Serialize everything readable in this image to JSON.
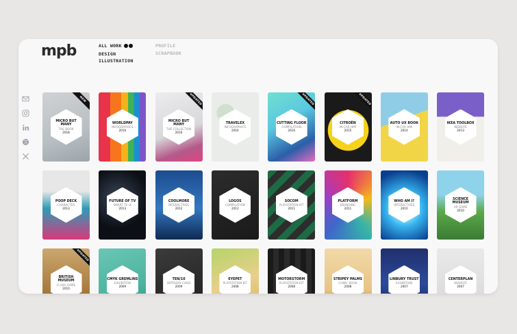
{
  "logo": "mpb",
  "nav": {
    "primary": [
      "ALL WORK",
      "DESIGN",
      "ILLUSTRATION"
    ],
    "secondary": [
      "PROFILE",
      "SCRAPBOOK"
    ]
  },
  "social_icons": [
    "email-icon",
    "instagram-icon",
    "linkedin-icon",
    "dribbble-icon",
    "x-icon"
  ],
  "cards": [
    {
      "title": "MICRO BUT MANY",
      "subtitle": "THE BOOK",
      "year": "2018",
      "badge": "NEW",
      "bg": "linear-gradient(160deg,#cfd2d4 0%,#b8bfc3 60%,#9aa4a9 100%)"
    },
    {
      "title": "WORLDPAY",
      "subtitle": "INFOGRAPHICS",
      "year": "2016",
      "badge": "",
      "bg": "linear-gradient(90deg,#e8344a 0 25%,#f7761d 25% 48%,#f4b119 48% 62%,#3db356 62% 75%,#1c8fd0 75% 87%,#7c55c9 87% 100%)"
    },
    {
      "title": "MICRO BUT MANY",
      "subtitle": "THE COLLECTION",
      "year": "2016",
      "badge": "UPDATED",
      "bg": "linear-gradient(160deg,#ecebed 0%,#d8d7da 55%,#b45a8a 80%,#e0447f 100%)"
    },
    {
      "title": "TRAVELEX",
      "subtitle": "INFOGRAPHICS",
      "year": "2016",
      "badge": "",
      "bg": "radial-gradient(circle at 30% 30%,#cfe0cf 0 15%,#e9ece9 16% 100%)"
    },
    {
      "title": "CUTTING FLOOR",
      "subtitle": "COMPILATION",
      "year": "2016",
      "badge": "UPDATED",
      "bg": "linear-gradient(150deg,#70e0d0 0%,#5ac8e0 40%,#2b5ea8 75%,#e46cc0 100%)"
    },
    {
      "title": "CITROËN",
      "subtitle": "IN-CAR HMI",
      "year": "2015",
      "badge": "UPDATED",
      "bg": "radial-gradient(circle at 50% 55%,#f6d21b 0 45%,#1a1a1a 46% 100%)"
    },
    {
      "title": "AUTO UX BOOK",
      "subtitle": "IN-CAR HMI",
      "year": "2014",
      "badge": "",
      "bg": "linear-gradient(160deg,#8fcde6 0 40%,#f1d546 40% 100%)"
    },
    {
      "title": "IKEA TOOLBOX",
      "subtitle": "WEBSITE",
      "year": "2013",
      "badge": "",
      "bg": "linear-gradient(180deg,#7a5fc8 0 35%,#f1efea 35% 100%)"
    },
    {
      "title": "POOP DECK",
      "subtitle": "CHARACTER",
      "year": "2013",
      "badge": "",
      "bg": "linear-gradient(180deg,#e7e7e7 0 30%,#2f9bb5 55%,#d8397b 100%)"
    },
    {
      "title": "FUTURE OF TV",
      "subtitle": "SMART TV UI",
      "year": "2013",
      "badge": "",
      "bg": "radial-gradient(circle at 40% 40%,#2a3340 0 20%,#0c1016 60%)"
    },
    {
      "title": "COOLMORE",
      "subtitle": "INTERACTIVES",
      "year": "2012",
      "badge": "",
      "bg": "linear-gradient(180deg,#1c4c8f 0%,#3477c0 55%,#0e2a52 100%)"
    },
    {
      "title": "LOGOS",
      "subtitle": "COMPILATION",
      "year": "2012",
      "badge": "",
      "bg": "linear-gradient(160deg,#2c2c2c 0%,#1a1a1a 100%)"
    },
    {
      "title": "SOCOM",
      "subtitle": "PLAYSTATION KIT",
      "year": "2011",
      "badge": "",
      "bg": "repeating-linear-gradient(135deg,#1d6a44 0 10px,#2d2d2d 10px 20px)"
    },
    {
      "title": "PLATFORM",
      "subtitle": "BRANDING",
      "year": "2011",
      "badge": "",
      "bg": "conic-gradient(#e6306d,#f5b91b,#36b4a8,#3f66c9,#9b3fc6,#e6306d)"
    },
    {
      "title": "WHO AM I?",
      "subtitle": "INTERACTIVES",
      "year": "2010",
      "badge": "",
      "bg": "radial-gradient(circle at 50% 55%,#bff4ff 0 15%,#36b4ef 40%,#0a3f8f 85%)"
    },
    {
      "title": "SCIENCE MUSEUM",
      "subtitle": "AR GAME",
      "year": "2010",
      "badge": "",
      "bg": "linear-gradient(180deg,#8fd3eb 0 35%,#5aa848 60%,#3c7b35 100%)"
    },
    {
      "title": "BRITISH MUSEUM",
      "subtitle": "FLASH GAME",
      "year": "2010",
      "badge": "UPDATED",
      "bg": "linear-gradient(180deg,#caa76e 0%,#a97a3f 60%,#6b4520 100%)"
    },
    {
      "title": "CMYK GREMLINS",
      "subtitle": "EXHIBITION",
      "year": "2009",
      "badge": "",
      "bg": "linear-gradient(160deg,#6cc5b5 0%,#4bb39f 60%,#2f8c7c 100%)"
    },
    {
      "title": "TEN/10",
      "subtitle": "BIRTHDAY CARD",
      "year": "2009",
      "badge": "",
      "bg": "linear-gradient(160deg,#3b3b3b 0%,#1e1e1e 100%)"
    },
    {
      "title": "EYEPET",
      "subtitle": "PLAYSTATION KIT",
      "year": "2008",
      "badge": "",
      "bg": "linear-gradient(160deg,#b5d46a 0%,#e8cf8a 50%,#d8b062 100%)"
    },
    {
      "title": "MOTORSTORM",
      "subtitle": "PLAYSTATION KIT",
      "year": "2008",
      "badge": "",
      "bg": "repeating-linear-gradient(90deg,#1a1a1a 0 8px,#2a2a2a 8px 16px)"
    },
    {
      "title": "STRIPEY PALMS",
      "subtitle": "COMIC BOOK",
      "year": "2008",
      "badge": "",
      "bg": "linear-gradient(180deg,#f1d9a8 0%,#e8c486 60%,#6b4a2f 100%)"
    },
    {
      "title": "LINBURY TRUST",
      "subtitle": "EXHIBITION",
      "year": "2007",
      "badge": "",
      "bg": "linear-gradient(180deg,#1f2f6c 0%,#2c4a9a 50%,#162146 100%)"
    },
    {
      "title": "CENTERPLAN",
      "subtitle": "WEBSITE",
      "year": "2007",
      "badge": "",
      "bg": "linear-gradient(180deg,#e9e9e9 0%,#d6d6d6 100%)"
    }
  ]
}
